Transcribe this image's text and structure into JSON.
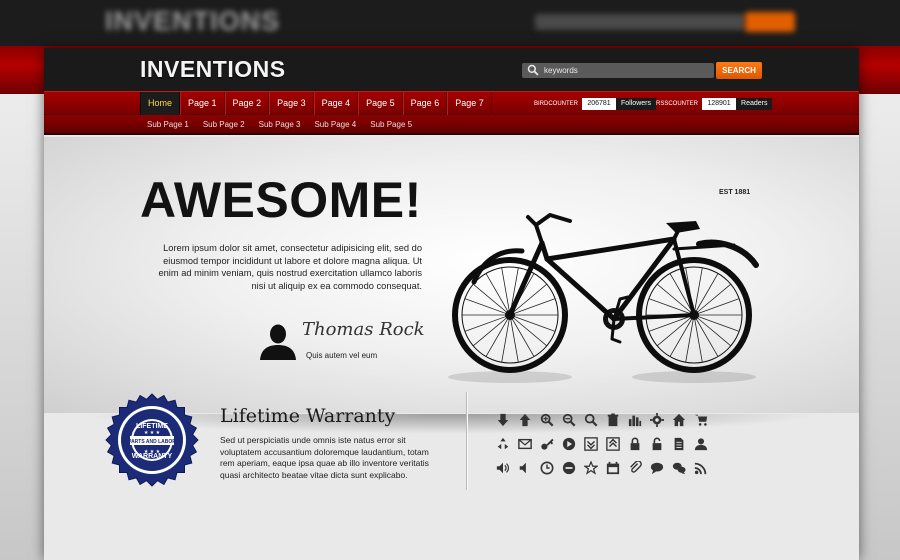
{
  "background": {
    "logo": "INVENTIONS"
  },
  "header": {
    "logo": "INVENTIONS",
    "search": {
      "placeholder": "keywords",
      "button_label": "SEARCH"
    }
  },
  "nav": {
    "items": [
      "Home",
      "Page 1",
      "Page 2",
      "Page 3",
      "Page 4",
      "Page 5",
      "Page 6",
      "Page 7"
    ],
    "active_index": 0
  },
  "counters": {
    "bird": {
      "label": "BIRDCOUNTER",
      "value": "206781",
      "suffix": "Followers"
    },
    "rss": {
      "label": "RSSCOUNTER",
      "value": "128901",
      "suffix": "Readers"
    }
  },
  "subnav": {
    "items": [
      "Sub Page 1",
      "Sub Page 2",
      "Sub Page 3",
      "Sub Page 4",
      "Sub Page 5"
    ]
  },
  "hero": {
    "title": "AWESOME!",
    "text": "Lorem ipsum dolor sit amet, consectetur adipisicing elit, sed do eiusmod tempor incididunt ut labore et dolore magna aliqua. Ut enim ad minim veniam, quis nostrud exercitation ullamco laboris nisi ut aliquip ex ea commodo consequat.",
    "signature": "Thomas Rock",
    "caption": "Quis autem vel eum",
    "est": "EST 1881"
  },
  "warranty": {
    "seal_top": "LIFETIME",
    "seal_middle": "PARTS AND LABOR",
    "seal_bottom": "WARRANTY",
    "title": "Lifetime Warranty",
    "text": "Sed ut perspiciatis unde omnis iste natus error sit voluptatem accusantium doloremque laudantium, totam rem aperiam, eaque ipsa quae ab illo inventore veritatis quasi architecto beatae vitae dicta sunt explicabo."
  },
  "colors": {
    "accent_orange": "#e15f00",
    "nav_red": "#a40000",
    "header_dark": "#1a1a1a",
    "active_text": "#ffd84a"
  },
  "icons": [
    "arrow-down-icon",
    "arrow-up-icon",
    "zoom-in-icon",
    "zoom-out-icon",
    "search-icon",
    "trash-icon",
    "bar-chart-icon",
    "gear-icon",
    "home-icon",
    "cart-icon",
    "recycle-icon",
    "mail-icon",
    "key-icon",
    "play-icon",
    "download-box-icon",
    "upload-box-icon",
    "lock-icon",
    "unlock-icon",
    "document-icon",
    "user-icon",
    "speaker-loud-icon",
    "speaker-icon",
    "clock-icon",
    "minus-circle-icon",
    "star-icon",
    "calendar-icon",
    "paperclip-icon",
    "chat-bubble-icon",
    "chat-bubbles-icon",
    "rss-icon"
  ]
}
